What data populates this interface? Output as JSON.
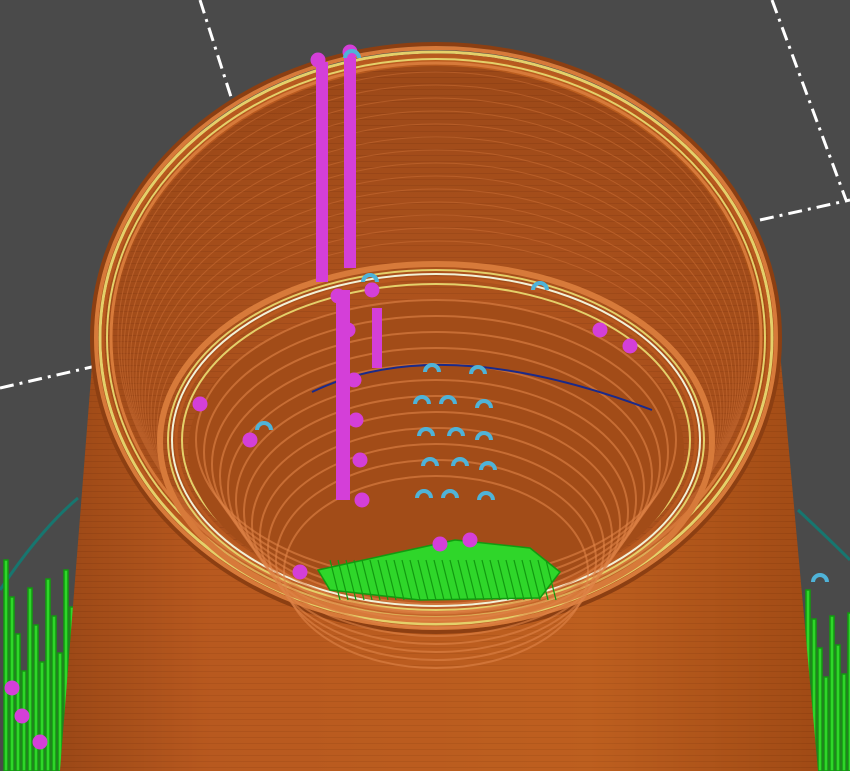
{
  "viewport": {
    "name": "gcode-preview-3d-view",
    "background": "#4a4a4a",
    "colors": {
      "perimeter": "#b8591f",
      "perimeter_dark": "#8c3f12",
      "perimeter_light": "#d77a3a",
      "rim_highlight": "#e4d06a",
      "rim_white": "#f2f2d8",
      "support": "#2fd62a",
      "support_dark": "#129a10",
      "retraction": "#d43fd8",
      "wipe": "#4fb3d8",
      "travel": "#1a2a8a",
      "skirt": "#17766f",
      "bed_grid": "#ffffff"
    },
    "icons": {
      "retraction_marker": "retraction-marker-icon",
      "wipe_marker": "wipe-marker-icon"
    }
  }
}
